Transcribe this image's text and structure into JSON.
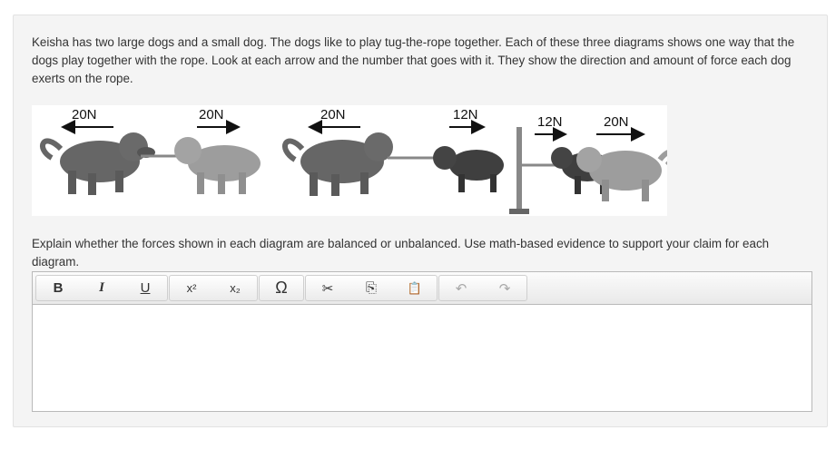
{
  "question": {
    "prompt": "Keisha has two large dogs and a small dog. The dogs like to play tug-the-rope together. Each of these three diagrams shows one way that the dogs play together with the rope. Look at each arrow and the number that goes with it. They show the direction and amount of force each dog exerts on the rope.",
    "instruction": "Explain whether the forces shown in each diagram are balanced or unbalanced. Use math-based evidence to support your claim for each diagram."
  },
  "diagram": {
    "d1_left": "20N",
    "d1_right": "20N",
    "d2_left": "20N",
    "d2_right": "12N",
    "d3_first": "12N",
    "d3_second": "20N"
  },
  "toolbar": {
    "bold": "B",
    "italic": "I",
    "underline": "U",
    "superscript": "x²",
    "subscript": "x₂",
    "special_char": "Ω",
    "cut": "✂",
    "copy": "⎘",
    "paste": "📋",
    "undo": "↶",
    "redo": "↷"
  },
  "editor": {
    "value": ""
  },
  "colors": {
    "dog_dark": "#5e5e5e",
    "dog_light": "#9a9a9a",
    "text": "#333333"
  }
}
